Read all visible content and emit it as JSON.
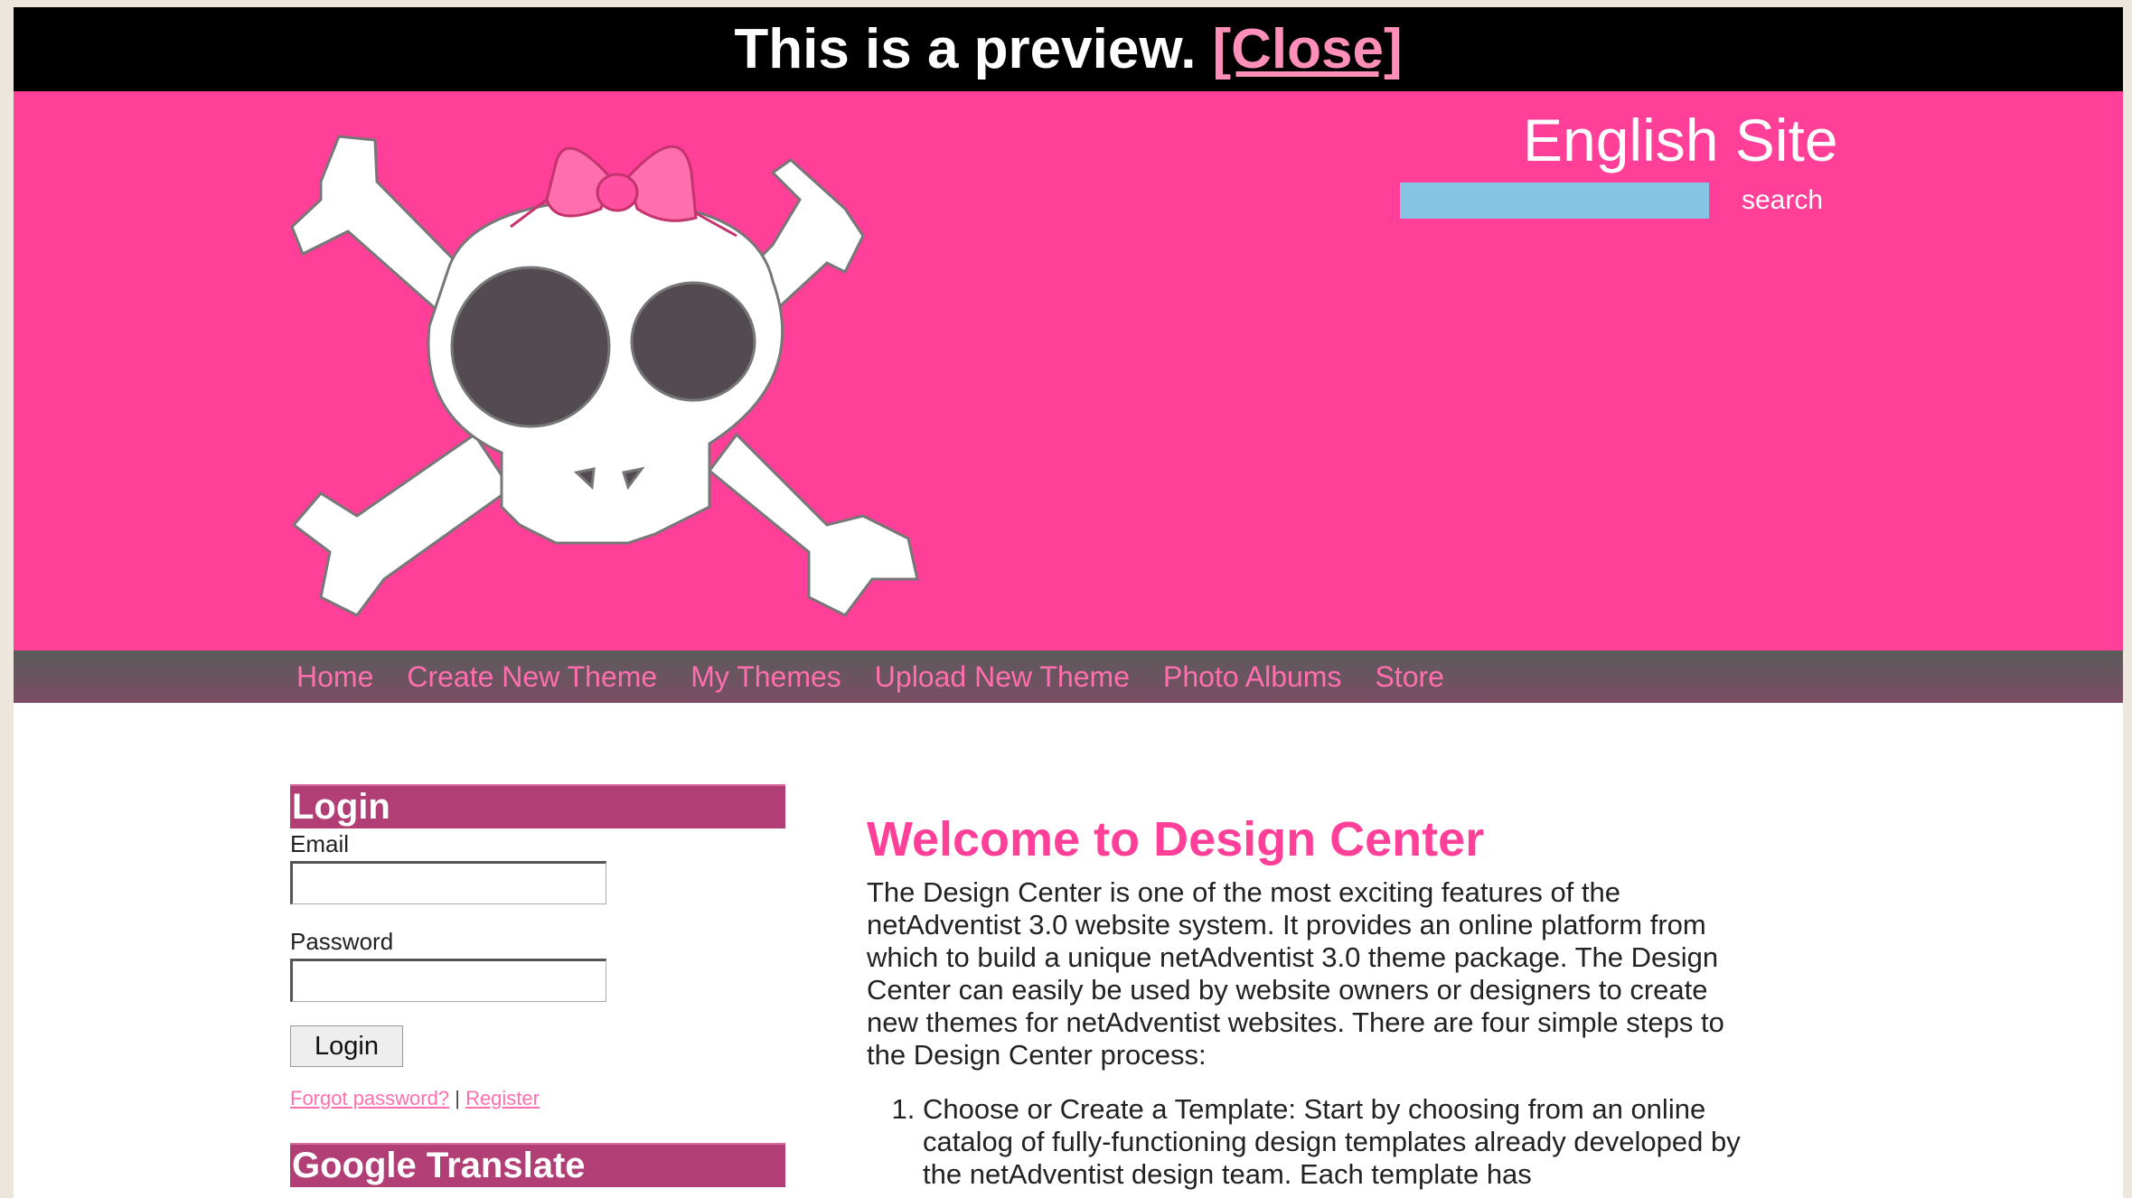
{
  "preview_bar": {
    "text": "This is a preview.",
    "close_label": "[Close]"
  },
  "header": {
    "site_title": "English Site",
    "search_placeholder": "",
    "search_label": "search"
  },
  "nav": {
    "items": [
      "Home",
      "Create New Theme",
      "My Themes",
      "Upload New Theme",
      "Photo Albums",
      "Store"
    ]
  },
  "sidebar": {
    "login": {
      "title": "Login",
      "email_label": "Email",
      "email_value": "",
      "password_label": "Password",
      "password_value": "",
      "button_label": "Login",
      "forgot_label": "Forgot password?",
      "separator": "|",
      "register_label": "Register"
    },
    "translate": {
      "title": "Google Translate"
    }
  },
  "main": {
    "title": "Welcome to Design Center",
    "intro": "The Design Center is one of the most exciting features of the netAdventist 3.0 website system. It provides an online platform from which to build a unique netAdventist 3.0 theme package. The Design Center can easily be used by website owners or designers to create new themes for netAdventist websites. There are four simple steps to the Design Center process:",
    "steps": [
      "Choose or Create a Template: Start by choosing from an online catalog of fully-functioning design templates already developed by the netAdventist design team. Each template has"
    ]
  },
  "colors": {
    "header_pink": "#ff3f98",
    "nav_text": "#ff6fae",
    "box_header": "#b13e74",
    "search_field": "#87c3e3"
  },
  "icons": {
    "logo": "skull-crossbones-bow-logo"
  }
}
